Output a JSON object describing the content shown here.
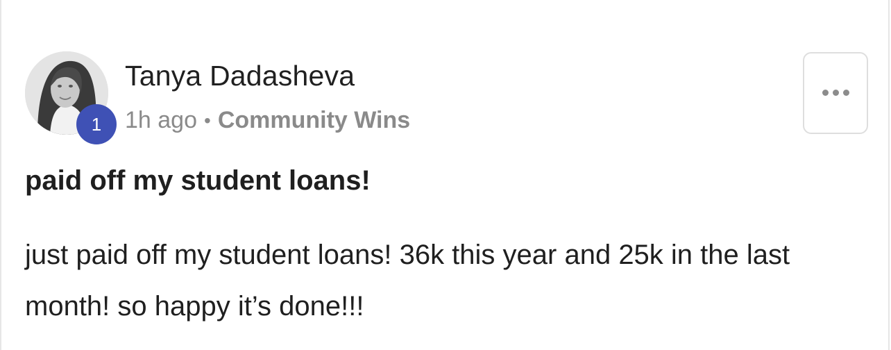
{
  "post": {
    "author": {
      "name": "Tanya Dadasheva",
      "level": "1"
    },
    "meta": {
      "time": "1h ago",
      "separator": "•",
      "category": "Community Wins"
    },
    "title": "paid off my student loans!",
    "body": "just paid off my student loans! 36k this year and 25k in the last month! so happy it’s done!!!"
  },
  "icons": {
    "more": "more-horizontal-icon"
  },
  "colors": {
    "badge": "#3f51b5",
    "meta_text": "#8a8a8a",
    "text": "#1f1f1f",
    "border": "#dedede"
  }
}
